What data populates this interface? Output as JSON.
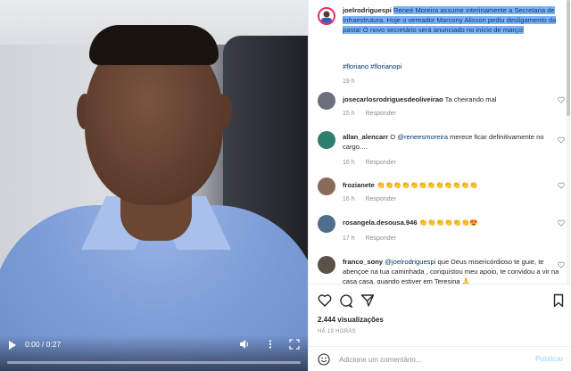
{
  "video": {
    "time": "0:00 / 0:27",
    "progress": 0.0,
    "icons": [
      "play-icon",
      "volume-icon",
      "more-icon",
      "fullscreen-icon"
    ]
  },
  "post": {
    "author": "joelrodriguespi",
    "caption_highlighted": "Reneé Moreira assume interinamente a Secretaria de Infraestrutura. Hoje o vereador Marcony Alisson pediu desligamento da pasta! O novo secretário será anunciado no início de março!",
    "tags": "#floriano #florianopi",
    "time": "19 h"
  },
  "comments": [
    {
      "user": "josecarlosrodriguesdeoliveirao",
      "text": "Ta cheirando mal",
      "mention": "",
      "time": "15 h",
      "reply": "Responder"
    },
    {
      "user": "allan_alencarr",
      "text_before": "O ",
      "mention": "@reneesmoreira",
      "text_after": " merece ficar definitivamente no cargo....",
      "time": "16 h",
      "reply": "Responder"
    },
    {
      "user": "frozianete",
      "text": "👏👏👏👏👏👏👏👏👏👏👏👏",
      "mention": "",
      "time": "16 h",
      "reply": "Responder"
    },
    {
      "user": "rosangela.desousa.946",
      "text": "👏👏👏👏👏👏😍",
      "mention": "",
      "time": "17 h",
      "reply": "Responder"
    },
    {
      "user": "franco_sony",
      "mention": "@joelrodriguespi",
      "text_after": " que Deus misericórdioso te guie, te abençoe na tua caminhada , conquistou meu apoio, te convidou a vir na casa casa, quando estiver em Teresina 🙏",
      "time": "",
      "reply": ""
    }
  ],
  "actions": {
    "views": "2.444 visualizações",
    "ago": "HÁ 19 HORAS",
    "icons": [
      "heart-icon",
      "comment-icon",
      "share-icon",
      "bookmark-icon"
    ]
  },
  "comment_box": {
    "placeholder": "Adicione um comentário...",
    "publish": "Publicar"
  }
}
